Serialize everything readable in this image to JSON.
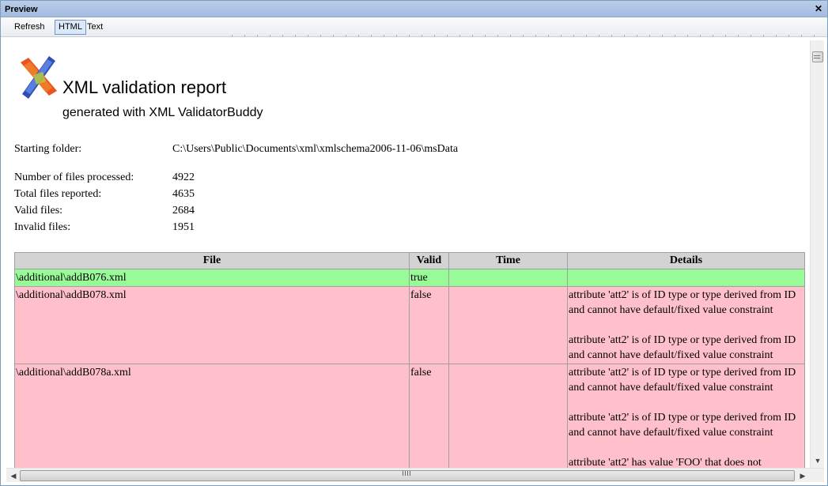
{
  "window": {
    "title": "Preview",
    "close_glyph": "✕"
  },
  "toolbar": {
    "refresh_label": "Refresh",
    "html_label": "HTML",
    "text_label": "Text",
    "active_tab": "HTML"
  },
  "report": {
    "title": "XML validation report",
    "subtitle": "generated with XML ValidatorBuddy",
    "starting_folder_label": "Starting folder:",
    "starting_folder": "C:\\Users\\Public\\Documents\\xml\\xmlschema2006-11-06\\msData",
    "files_processed_label": "Number of files processed:",
    "files_processed": "4922",
    "files_reported_label": "Total files reported:",
    "files_reported": "4635",
    "valid_label": "Valid files:",
    "valid_count": "2684",
    "invalid_label": "Invalid files:",
    "invalid_count": "1951"
  },
  "table": {
    "headers": [
      "File",
      "Valid",
      "Time",
      "Details"
    ],
    "rows": [
      {
        "file": "\\additional\\addB076.xml",
        "valid": "true",
        "time": "",
        "details": []
      },
      {
        "file": "\\additional\\addB078.xml",
        "valid": "false",
        "time": "",
        "details": [
          "attribute 'att2' is of ID type or type derived from ID and cannot have default/fixed value constraint",
          "attribute 'att2' is of ID type or type derived from ID and cannot have default/fixed value constraint"
        ]
      },
      {
        "file": "\\additional\\addB078a.xml",
        "valid": "false",
        "time": "",
        "details": [
          "attribute 'att2' is of ID type or type derived from ID and cannot have default/fixed value constraint",
          "attribute 'att2' is of ID type or type derived from ID and cannot have default/fixed value constraint",
          "attribute 'att2' has value 'FOO' that does not"
        ]
      }
    ]
  },
  "colors": {
    "valid_row": "#98fb98",
    "invalid_row": "#ffc0cb",
    "header_bg": "#d3d3d3",
    "titlebar": "#a4bcdf"
  },
  "icons": {
    "logo": "xml-validatorbuddy-logo",
    "close": "close-icon",
    "scroll_down": "arrow-down-icon",
    "scroll_left": "arrow-left-icon",
    "scroll_right": "arrow-right-icon"
  }
}
